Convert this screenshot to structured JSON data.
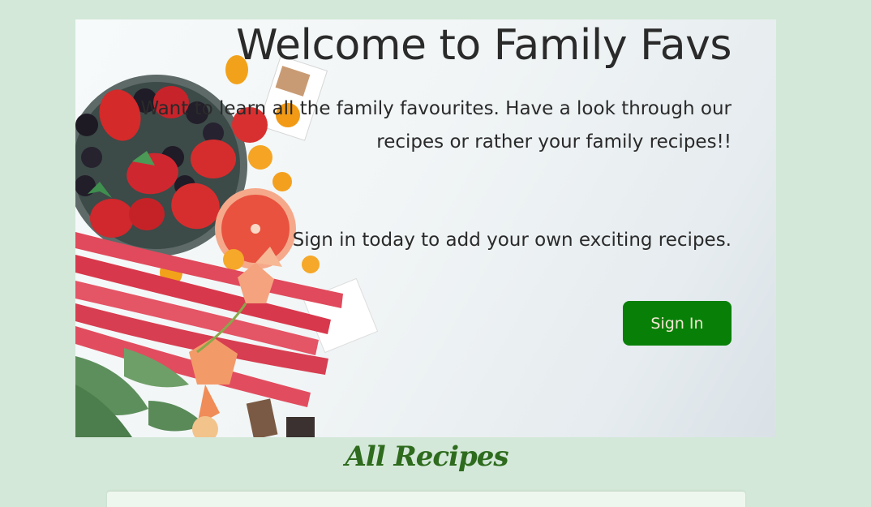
{
  "hero": {
    "title": "Welcome to Family Favs",
    "intro": "Want to learn all the family favourites. Have a look through our recipes or rather your family recipes!!",
    "signin_prompt": "Sign in today to add your own exciting recipes.",
    "signin_button": "Sign In",
    "image": "food-still-life-image"
  },
  "recipes": {
    "heading": "All Recipes"
  },
  "colors": {
    "page_background": "#d3e8d8",
    "button": "#088008",
    "heading": "#2e6b1e"
  }
}
